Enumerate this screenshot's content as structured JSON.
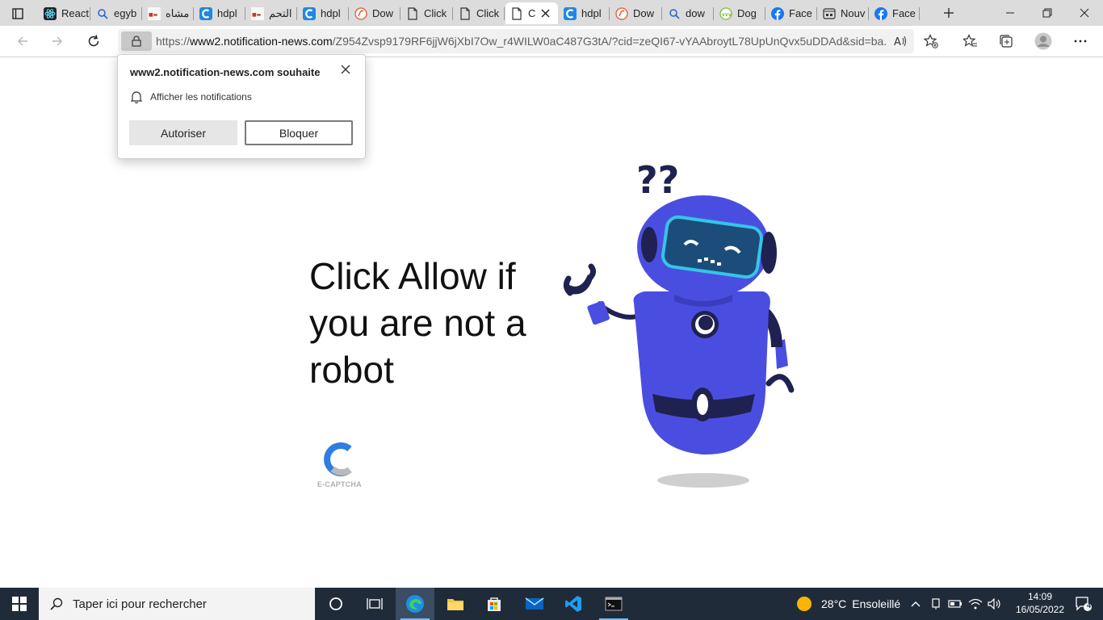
{
  "browser": {
    "tabs": [
      {
        "label": "React",
        "icon": "react-icon"
      },
      {
        "label": "egyb",
        "icon": "search-icon"
      },
      {
        "label": "مشاه",
        "icon": "site-icon"
      },
      {
        "label": "hdpl",
        "icon": "c-logo-icon"
      },
      {
        "label": "التحم",
        "icon": "site-icon"
      },
      {
        "label": "hdpl",
        "icon": "c-logo-icon"
      },
      {
        "label": "Dow",
        "icon": "download-site-icon"
      },
      {
        "label": "Click",
        "icon": "page-icon"
      },
      {
        "label": "Click",
        "icon": "page-icon"
      },
      {
        "label": "C",
        "icon": "page-icon",
        "active": true
      },
      {
        "label": "hdpl",
        "icon": "c-logo-icon"
      },
      {
        "label": "Dow",
        "icon": "download-site-icon"
      },
      {
        "label": "dow",
        "icon": "search-icon"
      },
      {
        "label": "Dog",
        "icon": "leaf-icon"
      },
      {
        "label": "Face",
        "icon": "facebook-icon"
      },
      {
        "label": "Nouv",
        "icon": "newtab-icon"
      },
      {
        "label": "Face",
        "icon": "facebook-icon"
      }
    ],
    "url_prefix": "https://",
    "url_host": "www2.notification-news.com",
    "url_path": "/Z954Zvsp9179RF6jjW6jXbI7Ow_r4WILW0aC487G3tA/?cid=zeQI67-vYAAbroytL78UpUnQvx5uDDAd&sid=ba..."
  },
  "notification_prompt": {
    "title": "www2.notification-news.com souhaite",
    "permission": "Afficher les notifications",
    "allow_label": "Autoriser",
    "block_label": "Bloquer"
  },
  "page": {
    "headline": "Click Allow if you are not a robot",
    "captcha_label": "E-CAPTCHA"
  },
  "taskbar": {
    "search_placeholder": "Taper ici pour rechercher",
    "weather_temp": "28°C",
    "weather_text": "Ensoleillé",
    "time": "14:09",
    "date": "16/05/2022",
    "notification_count": "4"
  },
  "colors": {
    "robot_body": "#4a4ee0",
    "robot_dark": "#1f2150",
    "visor": "#1c4d7a",
    "visor_rim": "#34c6e6",
    "accent_blue": "#0078d4"
  }
}
